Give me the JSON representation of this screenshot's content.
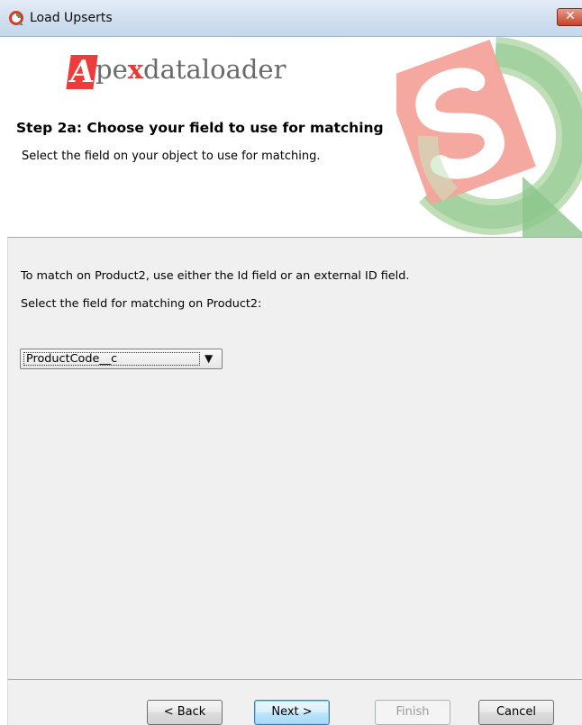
{
  "window": {
    "title": "Load Upserts",
    "close_glyph": "✕"
  },
  "header": {
    "logo": {
      "mark": "A",
      "text_before": "pe",
      "text_x": "x",
      "text_after": "dataloader"
    },
    "step_title": "Step 2a: Choose your field to use for matching",
    "step_subtitle": "Select the field on your object to use for matching."
  },
  "content": {
    "match_info": "To match on Product2, use either the Id field or an external ID field.",
    "select_label": "Select the field for matching on Product2:",
    "selected_field": "ProductCode__c",
    "dropdown_glyph": "▼"
  },
  "buttons": {
    "back": "< Back",
    "next": "Next >",
    "finish": "Finish",
    "cancel": "Cancel"
  },
  "colors": {
    "brand_red": "#ee3b3b",
    "emblem_green": "#7fbf7f",
    "emblem_pink": "#f28a8a"
  },
  "icons": [
    "app-icon",
    "close-icon",
    "emblem-icon",
    "dropdown-arrow-icon"
  ]
}
